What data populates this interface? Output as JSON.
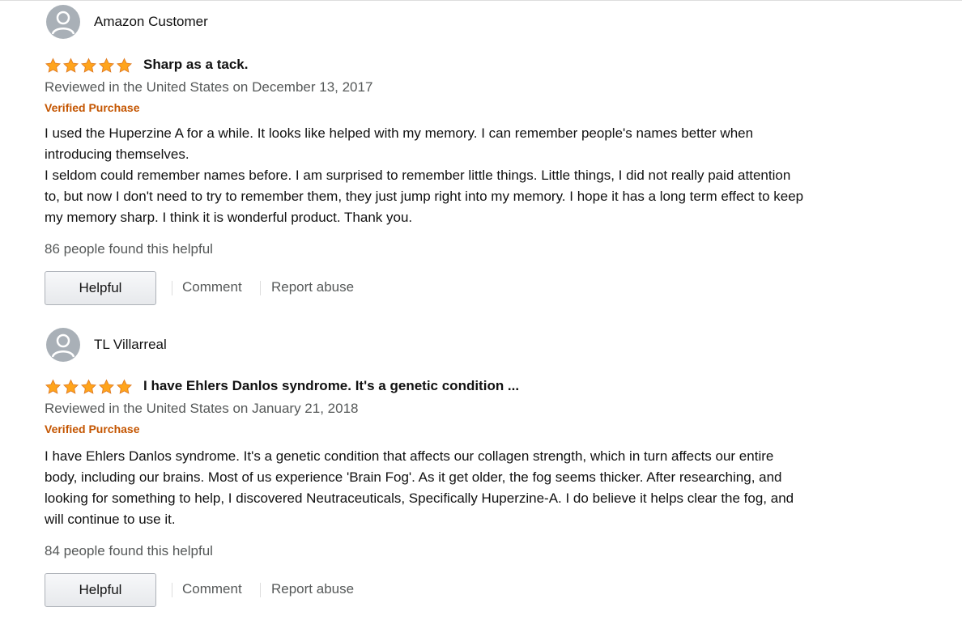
{
  "reviews": [
    {
      "author": "Amazon Customer",
      "rating": 5,
      "title": "Sharp as a tack.",
      "date": "Reviewed in the United States on December 13, 2017",
      "verified": "Verified Purchase",
      "body": [
        "I used the Huperzine A for a while. It looks like helped with my memory. I can remember people's names better when introducing themselves.",
        "I seldom could remember names before. I am surprised to remember little things. Little things, I did not really paid attention to, but now I don't need to try to remember them, they just jump right into my memory. I hope it has a long term effect to keep my memory sharp. I think it is wonderful product. Thank you."
      ],
      "helpful_count": "86 people found this helpful",
      "helpful_label": "Helpful",
      "comment_label": "Comment",
      "report_label": "Report abuse"
    },
    {
      "author": "TL Villarreal",
      "rating": 5,
      "title": "I have Ehlers Danlos syndrome. It's a genetic condition ...",
      "date": "Reviewed in the United States on January 21, 2018",
      "verified": "Verified Purchase",
      "body": [
        "I have Ehlers Danlos syndrome. It's a genetic condition that affects our collagen strength, which in turn affects our entire body, including our brains. Most of us experience 'Brain Fog'. As it get older, the fog seems thicker. After researching, and looking for something to help, I discovered Neutraceuticals, Specifically Huperzine-A. I do believe it helps clear the fog, and will continue to use it."
      ],
      "helpful_count": "84 people found this helpful",
      "helpful_label": "Helpful",
      "comment_label": "Comment",
      "report_label": "Report abuse"
    }
  ],
  "colors": {
    "star": "#ffa41c",
    "verified": "#c45500",
    "muted": "#565959",
    "avatar": "#a9b0b7"
  }
}
